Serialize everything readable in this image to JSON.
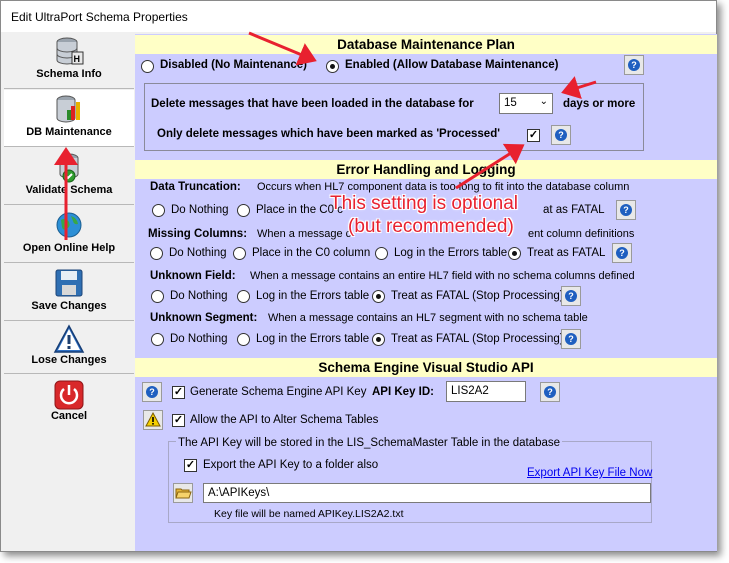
{
  "window": {
    "title": "Edit UltraPort Schema Properties"
  },
  "sidebar": {
    "items": [
      {
        "label": "Schema Info",
        "icon": "database-icon"
      },
      {
        "label": "DB Maintenance",
        "icon": "database-tools-icon"
      },
      {
        "label": "Validate Schema",
        "icon": "validate-icon"
      },
      {
        "label": "Open Online Help",
        "icon": "globe-help-icon"
      },
      {
        "label": "Save Changes",
        "icon": "floppy-disk-icon"
      },
      {
        "label": "Lose Changes",
        "icon": "warning-icon"
      },
      {
        "label": "Cancel",
        "icon": "power-icon"
      }
    ],
    "active": "DB Maintenance"
  },
  "maintenance": {
    "header": "Database Maintenance Plan",
    "disabled_label": "Disabled (No Maintenance)",
    "enabled_label": "Enabled (Allow Database Maintenance)",
    "selected": "enabled",
    "delete_label": "Delete messages that have been loaded in the database for",
    "days_value": "15",
    "days_suffix": "days or more",
    "processed_label": "Only delete messages which have been marked as 'Processed'",
    "processed_checked": true
  },
  "errors": {
    "header": "Error Handling and Logging",
    "data_truncation": {
      "title": "Data Truncation:",
      "desc": "Occurs when HL7 component data is too long to fit into the database column",
      "opt1": "Do Nothing",
      "opt2": "Place in the C0 c",
      "opt3": "at as FATAL"
    },
    "missing_columns": {
      "title": "Missing Columns:",
      "desc_a": "When a message c",
      "desc_b": "ent column definitions",
      "opt1": "Do Nothing",
      "opt2": "Place in the C0 column",
      "opt3": "Log in the Errors table",
      "opt4": "Treat as FATAL"
    },
    "unknown_field": {
      "title": "Unknown Field:",
      "desc": "When a  message contains an entire HL7 field with no schema columns defined",
      "opt1": "Do Nothing",
      "opt2": "Log in the Errors table",
      "opt3": "Treat as FATAL (Stop Processing)"
    },
    "unknown_segment": {
      "title": "Unknown Segment:",
      "desc": "When a  message contains an HL7 segment with no schema table",
      "opt1": "Do Nothing",
      "opt2": "Log in the Errors table",
      "opt3": "Treat as FATAL (Stop Processing)"
    }
  },
  "api": {
    "header": "Schema Engine Visual Studio API",
    "generate_label": "Generate Schema Engine API Key",
    "generate_checked": true,
    "key_id_label": "API Key ID:",
    "key_id_value": "LIS2A2",
    "alter_label": "Allow the API to Alter Schema Tables",
    "alter_checked": true,
    "storage_note": "The API Key will be stored in the LIS_SchemaMaster Table in the database",
    "export_label": "Export the API Key to a folder also",
    "export_checked": true,
    "export_link": "Export API Key File Now",
    "folder_value": "A:\\APIKeys\\",
    "key_file_note": "Key file will be named APIKey.LIS2A2.txt"
  },
  "annotation": {
    "line1": "This setting is optional",
    "line2": "(but recommended)"
  },
  "colors": {
    "header_bg": "#ffffc6",
    "panel_bg": "#ccccff",
    "arrow": "#e8212f",
    "link": "#0000ee"
  }
}
